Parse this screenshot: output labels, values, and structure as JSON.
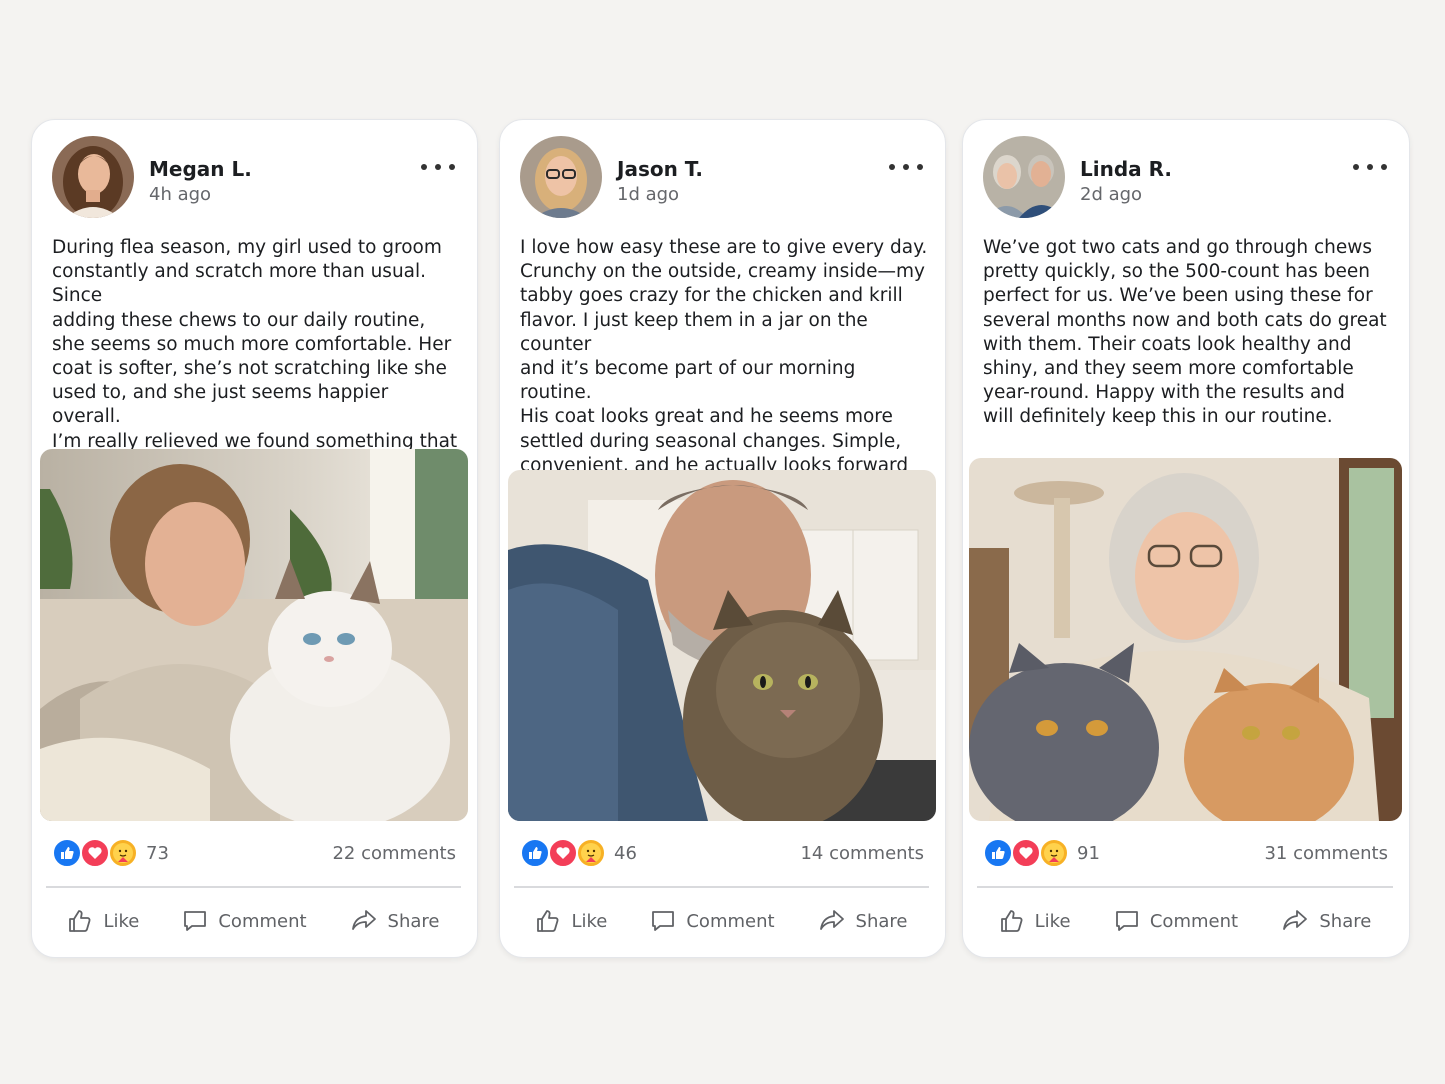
{
  "posts": [
    {
      "author": "Megan L.",
      "time": "4h ago",
      "text": "During flea season, my girl used to groom\nconstantly and scratch more than usual. Since\nadding these chews to our daily routine,\nshe seems so much more comfortable. Her\ncoat is softer, she’s not scratching like she\nused to, and she just seems happier overall.\nI’m really relieved we found something that\nfits so easily into our day.",
      "reaction_count": "73",
      "comments": "22 comments"
    },
    {
      "author": "Jason T.",
      "time": "1d ago",
      "text": "I love how easy these are to give every day.\nCrunchy on the outside, creamy inside—my\ntabby goes crazy for the chicken and krill\nflavor. I just keep them in a jar on the counter\nand it’s become part of our morning routine.\nHis coat looks great and he seems more\nsettled during seasonal changes. Simple,\nconvenient, and he actually looks forward\nto them.",
      "reaction_count": "46",
      "comments": "14 comments"
    },
    {
      "author": "Linda R.",
      "time": "2d ago",
      "text": "We’ve got two cats and go through chews\npretty quickly, so the 500-count has been\nperfect for us. We’ve been using these for\nseveral months now and both cats do great\nwith them. Their coats look healthy and\nshiny, and they seem more comfortable\nyear-round. Happy with the results and\nwill definitely keep this in our routine.",
      "reaction_count": "91",
      "comments": "31 comments"
    }
  ],
  "actions": {
    "like": "Like",
    "comment": "Comment",
    "share": "Share"
  },
  "reaction_icons": [
    "like-reaction-icon",
    "love-reaction-icon",
    "care-reaction-icon"
  ],
  "colors": {
    "like_blue": "#1877f2",
    "love_red": "#f33e58",
    "care_yellow": "#f7b125",
    "secondary_text": "#65676b"
  }
}
